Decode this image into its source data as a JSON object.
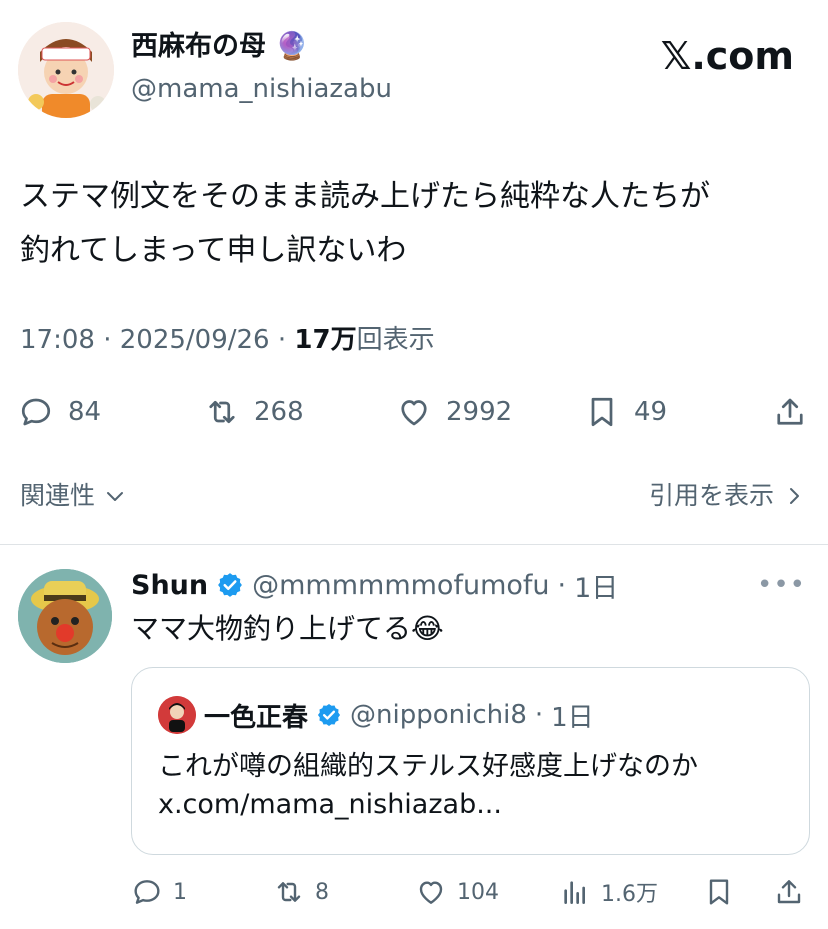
{
  "post": {
    "author_name": "西麻布の母",
    "author_emoji": "🔮",
    "author_handle": "@mama_nishiazabu",
    "brand": "𝕏.com",
    "text_line1": "ステマ例文をそのまま読み上げたら純粋な人たちが",
    "text_line2": "釣れてしまって申し訳ないわ",
    "time": "17:08",
    "date": "2025/09/26",
    "views_count": "17万",
    "views_label": "回表示",
    "replies": "84",
    "reposts": "268",
    "likes": "2992",
    "bookmarks": "49",
    "related_label": "関連性",
    "quotes_label": "引用を表示"
  },
  "reply": {
    "name": "Shun",
    "handle": "@mmmmmmofumofu",
    "time": "1日",
    "text": "ママ大物釣り上げてる😂",
    "replies": "1",
    "reposts": "8",
    "likes": "104",
    "views": "1.6万"
  },
  "quote": {
    "name": "一色正春",
    "handle": "@nipponichi8",
    "time": "1日",
    "text": "これが噂の組織的ステルス好感度上げなのか",
    "link": "x.com/mama_nishiazab..."
  },
  "colors": {
    "verified": "#1d9bf0",
    "text": "#0f1419",
    "muted": "#536471",
    "divider": "#dfe3e6"
  }
}
